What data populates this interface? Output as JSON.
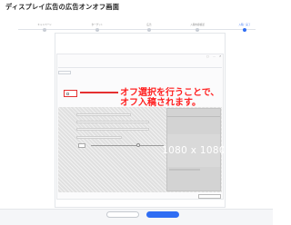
{
  "page": {
    "title": "ディスプレイ広告の広告オンオフ画面"
  },
  "steps": [
    {
      "label": "キャンペーン"
    },
    {
      "label": "ターゲット"
    },
    {
      "label": "広告"
    },
    {
      "label": "入稿内容確認"
    },
    {
      "label": "入稿・完了"
    }
  ],
  "annotation": {
    "line1": "オフ選択を行うことで、",
    "line2": "オフ入稿されます。"
  },
  "preview": {
    "size_label": "1080 x 1080"
  },
  "colors": {
    "accent": "#2f6df3",
    "highlight": "#e53030",
    "annotation": "#ff2020"
  }
}
